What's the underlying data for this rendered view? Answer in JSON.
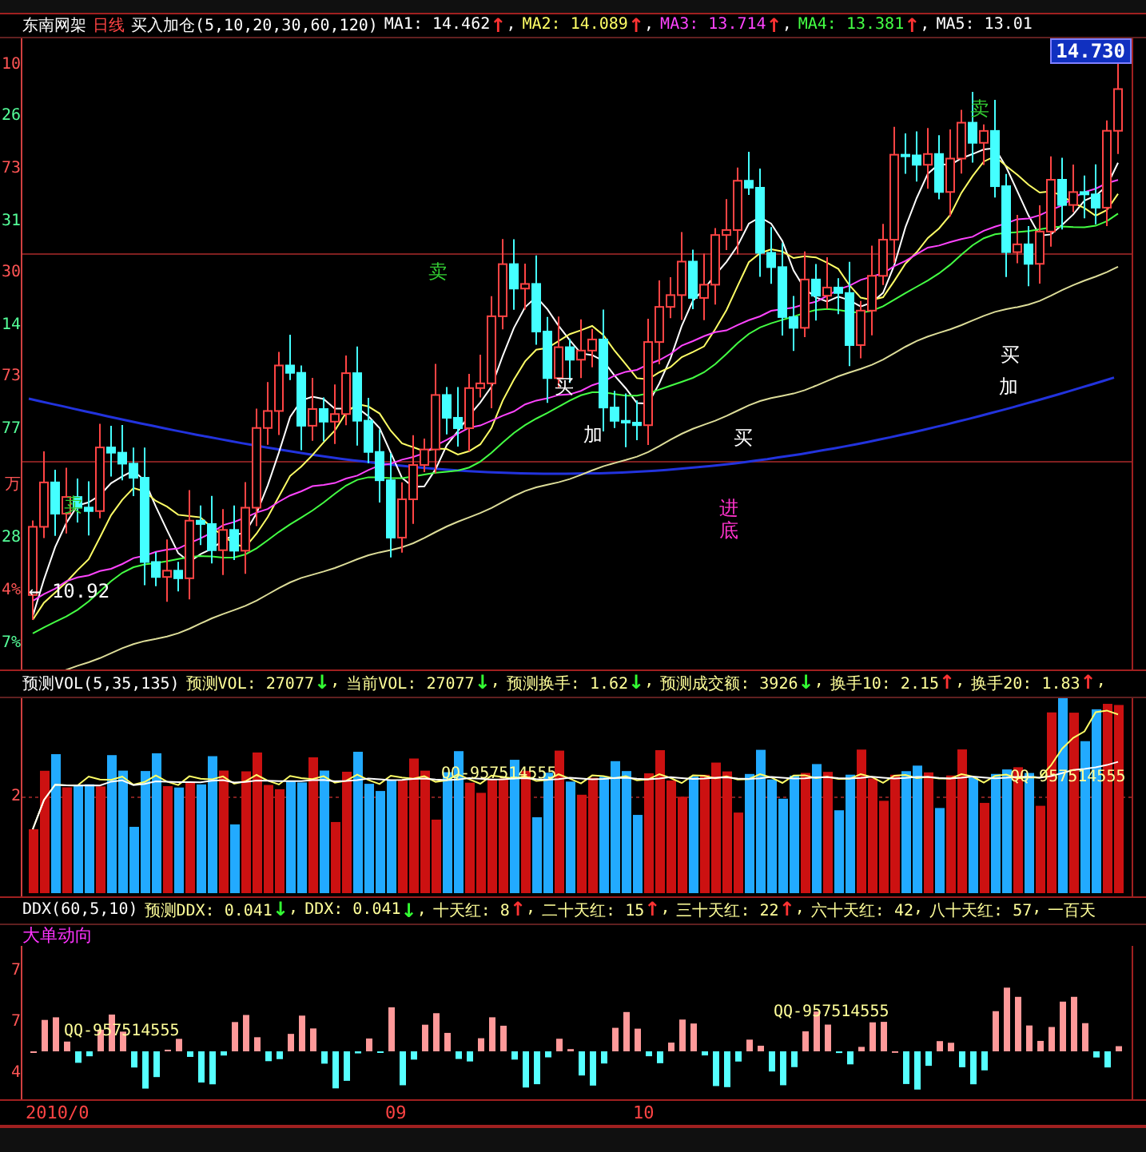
{
  "header": {
    "stock": "东南网架",
    "period": "日线",
    "indicator": "买入加仓(5,10,20,30,60,120)",
    "mas": [
      {
        "text": "MA1: 14.462",
        "arrow": {
          "text": "↑",
          "color": "#ff3333"
        },
        "tail": ",",
        "color": "#ffffff"
      },
      {
        "text": "MA2: 14.089",
        "arrow": {
          "text": "↑",
          "color": "#ff3333"
        },
        "tail": ",",
        "color": "#ffff66"
      },
      {
        "text": "MA3: 13.714",
        "arrow": {
          "text": "↑",
          "color": "#ff3333"
        },
        "tail": ",",
        "color": "#ff44ff"
      },
      {
        "text": "MA4: 13.381",
        "arrow": {
          "text": "↑",
          "color": "#ff3333"
        },
        "tail": ",",
        "color": "#44ff44"
      },
      {
        "text": "MA5: 13.01",
        "color": "#ffffff"
      }
    ]
  },
  "price_tag": "14.730",
  "price_axis": [
    "10",
    "26",
    "73",
    "31",
    "30",
    "14",
    "73",
    "77",
    "万",
    "28",
    "4%",
    "7%"
  ],
  "annotations": [
    {
      "text": "卖",
      "color": "#33cc33"
    },
    {
      "text": "卖",
      "color": "#33cc33"
    },
    {
      "text": "卖",
      "color": "#33cc33"
    },
    {
      "text": "买",
      "color": "#ffffff"
    },
    {
      "text": "买",
      "color": "#ffffff"
    },
    {
      "text": "买",
      "color": "#ffffff"
    },
    {
      "text": "加",
      "color": "#ffffff"
    },
    {
      "text": "加",
      "color": "#ffffff"
    },
    {
      "text": "进",
      "color": "#ff33cc"
    },
    {
      "text": "底",
      "color": "#ff33cc"
    },
    {
      "text": "← 10.92",
      "color": "#ffffff"
    }
  ],
  "volume": {
    "title": "预测VOL(5,35,135)",
    "items": [
      {
        "text": "预测VOL: 27077",
        "arrow": {
          "text": "↓",
          "color": "#33ff33"
        },
        "tail": ","
      },
      {
        "text": "当前VOL: 27077",
        "arrow": {
          "text": "↓",
          "color": "#33ff33"
        },
        "tail": ","
      },
      {
        "text": "预测换手: 1.62",
        "arrow": {
          "text": "↓",
          "color": "#33ff33"
        },
        "tail": ","
      },
      {
        "text": "预测成交额: 3926",
        "arrow": {
          "text": "↓",
          "color": "#33ff33"
        },
        "tail": ","
      },
      {
        "text": "换手10: 2.15",
        "arrow": {
          "text": "↑",
          "color": "#ff3333"
        },
        "tail": ","
      },
      {
        "text": "换手20: 1.83",
        "arrow": {
          "text": "↑",
          "color": "#ff3333"
        },
        "tail": ","
      }
    ],
    "axis": [
      "2"
    ],
    "watermarks": [
      "QQ-957514555",
      "QQ-957514555"
    ]
  },
  "ddx": {
    "title": "DDX(60,5,10)",
    "items": [
      {
        "text": "预测DDX: 0.041",
        "arrow": {
          "text": "↓",
          "color": "#33ff33"
        },
        "tail": ","
      },
      {
        "text": "DDX: 0.041",
        "arrow": {
          "text": "↓",
          "color": "#33ff33"
        },
        "tail": ","
      },
      {
        "text": "十天红: 8",
        "arrow": {
          "text": "↑",
          "color": "#ff3333"
        },
        "tail": ","
      },
      {
        "text": "二十天红: 15",
        "arrow": {
          "text": "↑",
          "color": "#ff3333"
        },
        "tail": ","
      },
      {
        "text": "三十天红: 22",
        "arrow": {
          "text": "↑",
          "color": "#ff3333"
        },
        "tail": ","
      },
      {
        "text": "六十天红: 42",
        "tail": ","
      },
      {
        "text": "八十天红: 57",
        "tail": ","
      },
      {
        "text": "一百天"
      }
    ],
    "subtitle": "大单动向",
    "axis": [
      "7",
      "7",
      "4"
    ],
    "watermarks": [
      "QQ-957514555",
      "QQ-957514555"
    ]
  },
  "time_axis": [
    "2010/0",
    "09",
    "10"
  ]
}
